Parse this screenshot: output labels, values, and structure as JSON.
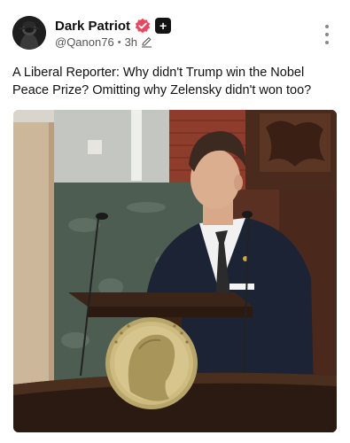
{
  "author": {
    "display_name": "Dark Patriot",
    "handle": "@Qanon76",
    "time_ago": "3h",
    "separator": "•",
    "avatar_icon": "hooded-figure-avatar",
    "verified_icon": "verified-badge-icon",
    "plus_badge": "+",
    "edit_icon": "pencil-edit-icon"
  },
  "post": {
    "text": "A Liberal Reporter: Why didn't Trump win the Nobel Peace Prize? Omitting why Zelensky didn't won too?"
  },
  "media": {
    "type": "image",
    "description_icons": [
      "nobel-medal-icon",
      "speaker-at-podium"
    ]
  },
  "colors": {
    "verified": "#e8475f",
    "text": "#111111",
    "meta": "#555555"
  }
}
